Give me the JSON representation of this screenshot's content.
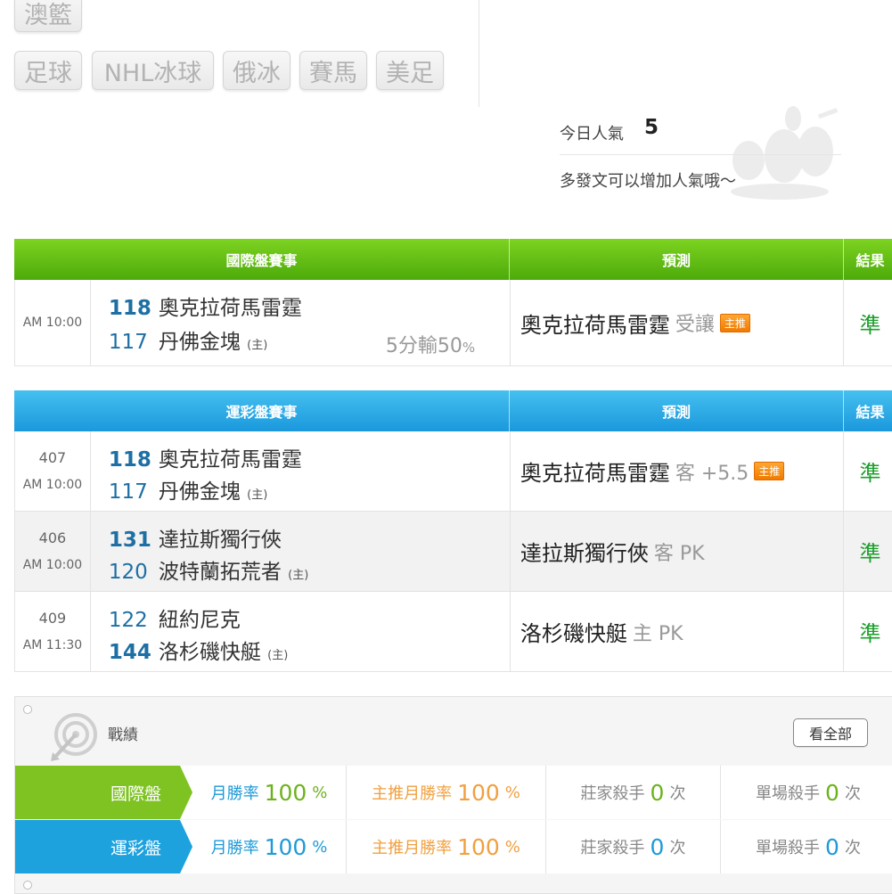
{
  "sports": {
    "top": "澳籃",
    "row": [
      "足球",
      "NHL冰球",
      "俄冰",
      "賽馬",
      "美足"
    ]
  },
  "popularity": {
    "label": "今日人氣",
    "value": "5",
    "hint": "多發文可以增加人氣哦～"
  },
  "intl_table": {
    "headers": [
      "國際盤賽事",
      "預測",
      "結果"
    ],
    "rows": [
      {
        "time": "AM 10:00",
        "away_num": "118",
        "away_team": "奧克拉荷馬雷霆",
        "home_num": "117",
        "home_team": "丹佛金塊",
        "home_mark": "(主)",
        "odds_main": "5分輸50",
        "odds_pct": "%",
        "pred_team": "奧克拉荷馬雷霆",
        "pred_ext": "受讓",
        "badge": "主推",
        "result": "準"
      }
    ]
  },
  "lottery_table": {
    "headers": [
      "運彩盤賽事",
      "預測",
      "結果"
    ],
    "rows": [
      {
        "game_no": "407",
        "time": "AM 10:00",
        "away_num": "118",
        "away_team": "奧克拉荷馬雷霆",
        "home_num": "117",
        "home_team": "丹佛金塊",
        "home_mark": "(主)",
        "pred_team": "奧克拉荷馬雷霆",
        "pred_ext": "客 +5.5",
        "badge": "主推",
        "result": "準"
      },
      {
        "game_no": "406",
        "time": "AM 10:00",
        "away_num": "131",
        "away_team": "達拉斯獨行俠",
        "home_num": "120",
        "home_team": "波特蘭拓荒者",
        "home_mark": "(主)",
        "pred_team": "達拉斯獨行俠",
        "pred_ext": "客 PK",
        "result": "準"
      },
      {
        "game_no": "409",
        "time": "AM 11:30",
        "away_num": "122",
        "away_team": "紐約尼克",
        "home_num": "144",
        "home_team": "洛杉磯快艇",
        "home_mark": "(主)",
        "pred_team": "洛杉磯快艇",
        "pred_ext": "主 PK",
        "result": "準"
      }
    ]
  },
  "stats": {
    "title": "戰績",
    "view_all": "看全部",
    "rows": [
      {
        "label": "國際盤",
        "month_label": "月勝率",
        "month_val": "100",
        "pct": "%",
        "main_label": "主推月勝率",
        "main_val": "100",
        "banker_label": "莊家殺手",
        "banker_val": "0",
        "single_label": "單場殺手",
        "single_val": "0",
        "unit": "次"
      },
      {
        "label": "運彩盤",
        "month_label": "月勝率",
        "month_val": "100",
        "pct": "%",
        "main_label": "主推月勝率",
        "main_val": "100",
        "banker_label": "莊家殺手",
        "banker_val": "0",
        "single_label": "單場殺手",
        "single_val": "0",
        "unit": "次"
      }
    ]
  }
}
